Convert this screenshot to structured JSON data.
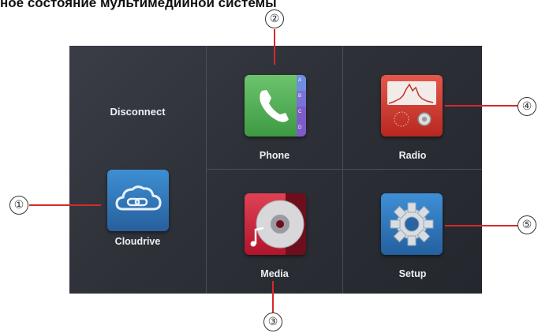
{
  "heading": "ное состояние мультимедийной системы",
  "screen": {
    "status_text": "Disconnect",
    "apps": [
      {
        "label": "Cloudrive",
        "icon": "cloud-link-icon"
      },
      {
        "label": "Phone",
        "icon": "phone-icon",
        "index_letters": [
          "A",
          "B",
          "C",
          "D"
        ]
      },
      {
        "label": "Radio",
        "icon": "radio-icon"
      },
      {
        "label": "Media",
        "icon": "media-disc-icon"
      },
      {
        "label": "Setup",
        "icon": "gear-icon"
      }
    ]
  },
  "callouts": [
    "①",
    "②",
    "③",
    "④",
    "⑤"
  ],
  "colors": {
    "callout_line": "#d6292a",
    "cloud_tile": "#2f78b8",
    "phone_tile": "#4fb053",
    "radio_tile": "#d2392f",
    "media_tile": "#c8283d",
    "setup_tile": "#2e74b5"
  }
}
